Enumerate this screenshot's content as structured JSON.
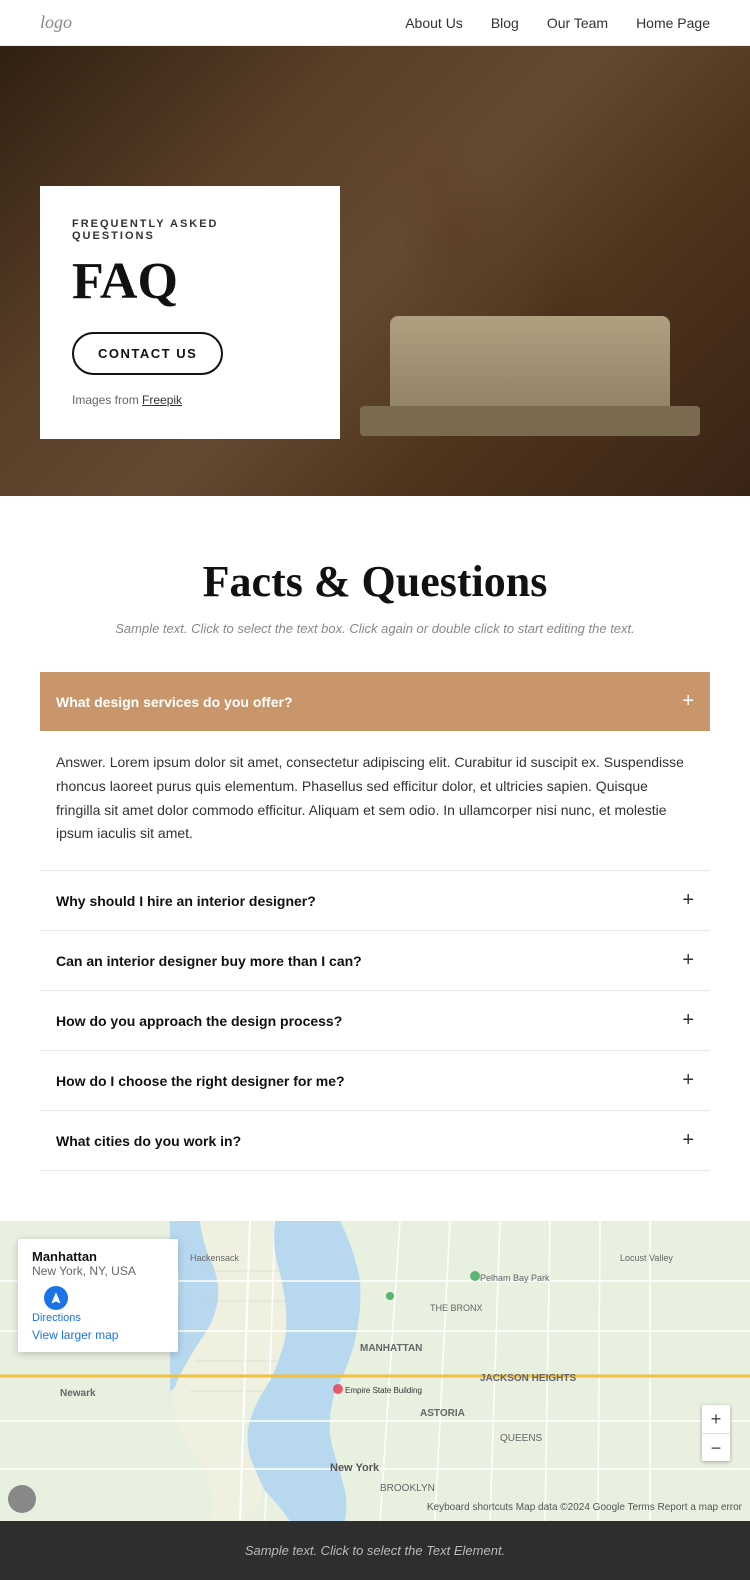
{
  "nav": {
    "logo": "logo",
    "links": [
      {
        "label": "About Us",
        "href": "#"
      },
      {
        "label": "Blog",
        "href": "#"
      },
      {
        "label": "Our Team",
        "href": "#"
      },
      {
        "label": "Home Page",
        "href": "#"
      }
    ]
  },
  "hero": {
    "subtitle": "FREQUENTLY ASKED QUESTIONS",
    "title": "FAQ",
    "cta_label": "CONTACT US",
    "images_prefix": "Images from",
    "images_link": "Freepik"
  },
  "facts": {
    "heading": "Facts & Questions",
    "sample_text": "Sample text. Click to select the text box. Click again or double click to start editing the text.",
    "faq_items": [
      {
        "question": "What design services do you offer?",
        "answer": "Answer. Lorem ipsum dolor sit amet, consectetur adipiscing elit. Curabitur id suscipit ex. Suspendisse rhoncus laoreet purus quis elementum. Phasellus sed efficitur dolor, et ultricies sapien. Quisque fringilla sit amet dolor commodo efficitur. Aliquam et sem odio. In ullamcorper nisi nunc, et molestie ipsum iaculis sit amet.",
        "active": true
      },
      {
        "question": "Why should I hire an interior designer?",
        "answer": "",
        "active": false
      },
      {
        "question": "Can an interior designer buy more than I can?",
        "answer": "",
        "active": false
      },
      {
        "question": "How do you approach the design process?",
        "answer": "",
        "active": false
      },
      {
        "question": "How do I choose the right designer for me?",
        "answer": "",
        "active": false
      },
      {
        "question": "What cities do you work in?",
        "answer": "",
        "active": false
      }
    ]
  },
  "map": {
    "location_title": "Manhattan",
    "location_sub": "New York, NY, USA",
    "directions_label": "Directions",
    "larger_map_label": "View larger map",
    "attribution": "Keyboard shortcuts  Map data ©2024 Google  Terms  Report a map error"
  },
  "footer": {
    "text": "Sample text. Click to select the Text Element."
  }
}
